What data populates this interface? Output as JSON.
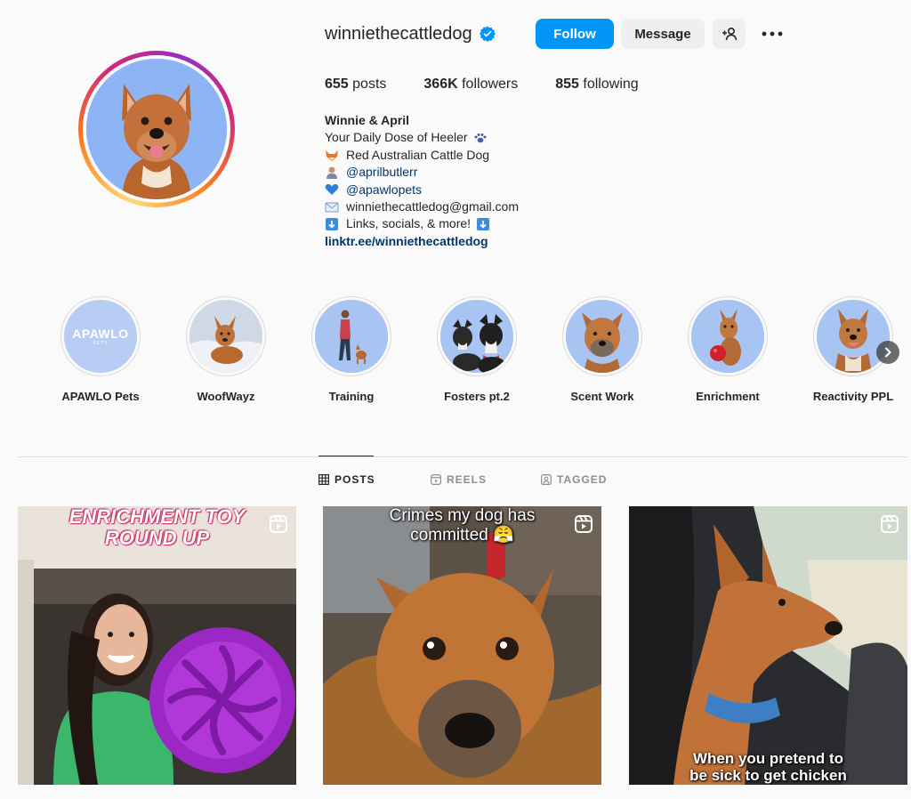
{
  "profile": {
    "username": "winniethecattledog",
    "follow_label": "Follow",
    "message_label": "Message",
    "stats": {
      "posts_count": "655",
      "posts_label": "posts",
      "followers_count": "366K",
      "followers_label": "followers",
      "following_count": "855",
      "following_label": "following"
    },
    "bio": {
      "name": "Winnie & April",
      "lines": [
        "Your Daily Dose of Heeler",
        "Red Australian Cattle Dog",
        "@aprilbutlerr",
        "@apawlopets",
        "winniethecattledog@gmail.com",
        "Links, socials, & more!"
      ],
      "link": "linktr.ee/winniethecattledog"
    }
  },
  "highlights": [
    {
      "label": "APAWLO Pets",
      "logo_text": "APAWLO",
      "logo_sub": "PETS"
    },
    {
      "label": "WoofWayz"
    },
    {
      "label": "Training"
    },
    {
      "label": "Fosters pt.2"
    },
    {
      "label": "Scent Work"
    },
    {
      "label": "Enrichment"
    },
    {
      "label": "Reactivity PPL"
    }
  ],
  "tabs": [
    {
      "label": "POSTS",
      "icon": "grid-icon",
      "active": true
    },
    {
      "label": "REELS",
      "icon": "reels-icon",
      "active": false
    },
    {
      "label": "TAGGED",
      "icon": "tagged-icon",
      "active": false
    }
  ],
  "posts": [
    {
      "caption_lines": [
        "ENRICHMENT TOY",
        "ROUND UP"
      ]
    },
    {
      "caption_lines": [
        "Crimes my dog has",
        "committed 😤"
      ]
    },
    {
      "caption_lines": [
        "When you pretend to",
        "be sick to get chicken"
      ]
    }
  ],
  "colors": {
    "accent": "#0095f6",
    "link": "#00376b",
    "verified": "#0095f6"
  }
}
